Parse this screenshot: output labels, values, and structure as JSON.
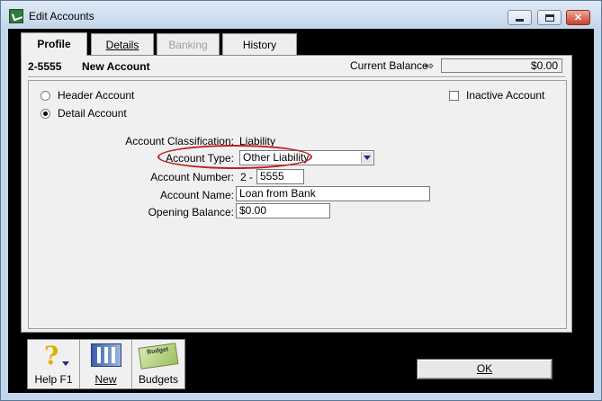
{
  "window": {
    "title": "Edit Accounts",
    "app_icon": "myob-icon",
    "controls": [
      "minimize-icon",
      "maximize-icon",
      "close-icon"
    ]
  },
  "tabs": [
    {
      "label": "Profile",
      "active": true,
      "enabled": true
    },
    {
      "label": "Details",
      "active": false,
      "enabled": true
    },
    {
      "label": "Banking",
      "active": false,
      "enabled": false
    },
    {
      "label": "History",
      "active": false,
      "enabled": true
    }
  ],
  "header": {
    "account_id": "2-5555",
    "account_name": "New Account",
    "current_balance_label": "Current Balance",
    "current_balance_icon": "arrow-right-icon",
    "current_balance_value": "$0.00"
  },
  "options": {
    "header_account_label": "Header Account",
    "detail_account_label": "Detail Account",
    "selected": "Detail Account",
    "inactive_label": "Inactive Account",
    "inactive_checked": false
  },
  "form": {
    "classification_label": "Account Classification:",
    "classification_value": "Liability",
    "type_label": "Account Type:",
    "type_value": "Other Liability",
    "number_label": "Account Number:",
    "number_prefix": "2 -",
    "number_value": "5555",
    "name_label": "Account Name:",
    "name_value": "Loan from Bank",
    "opening_label": "Opening Balance:",
    "opening_value": "$0.00"
  },
  "toolbar": {
    "help_label": "Help F1",
    "new_label": "New",
    "budgets_label": "Budgets",
    "budget_icon_text": "Budget"
  },
  "ok_label": "OK",
  "colors": {
    "highlight": "#c02020",
    "titlebar": "#c3d5ea",
    "panel": "#f0f0f0"
  }
}
